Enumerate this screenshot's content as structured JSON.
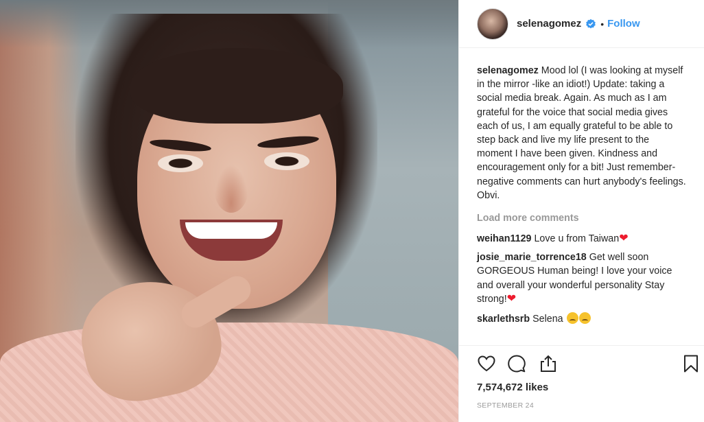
{
  "post": {
    "username": "selenagomez",
    "follow_label": "Follow",
    "separator": "•",
    "verified_icon": "verified-badge-icon",
    "accent_color": "#3897f0",
    "caption_user": "selenagomez",
    "caption_text": "Mood lol (I was looking at myself in the mirror -like an idiot!) Update: taking a social media break. Again. As much as I am grateful for the voice that social media gives each of us, I am equally grateful to be able to step back and live my life present to the moment I have been given. Kindness and encouragement only for a bit! Just remember- negative comments can hurt anybody's feelings. Obvi.",
    "load_more": "Load more comments",
    "comments": [
      {
        "user": "weihan1129",
        "text": "Love u from Taiwan",
        "emoji": "❤"
      },
      {
        "user": "josie_marie_torrence18",
        "text": "Get well soon GORGEOUS Human being! I love your voice and overall your wonderful personality Stay strong!",
        "emoji": "❤"
      },
      {
        "user": "skarlethsrb",
        "text": "Selena",
        "emoji": "disappointed-face-x2"
      }
    ],
    "likes": "7,574,672 likes",
    "date": "SEPTEMBER 24",
    "action_icons": [
      "heart-icon",
      "comment-icon",
      "share-icon",
      "bookmark-icon"
    ]
  }
}
